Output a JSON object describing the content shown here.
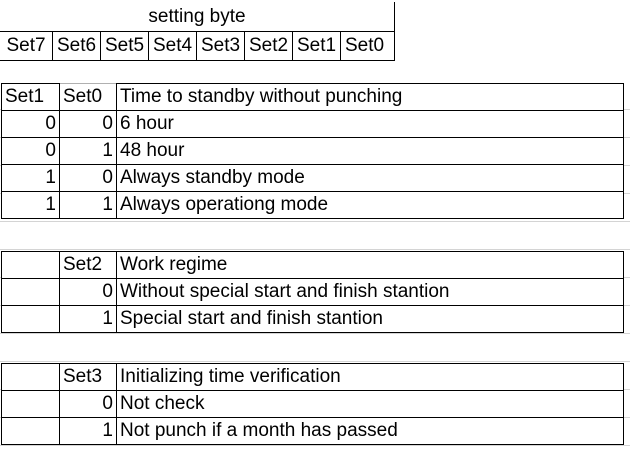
{
  "byte_table": {
    "title": "setting byte",
    "bits": [
      "Set7",
      "Set6",
      "Set5",
      "Set4",
      "Set3",
      "Set2",
      "Set1",
      "Set0"
    ]
  },
  "blocks": [
    {
      "header": [
        "Set1",
        "Set0",
        "Time to standby without punching"
      ],
      "rows": [
        [
          "0",
          "0",
          "6 hour"
        ],
        [
          "0",
          "1",
          "48 hour"
        ],
        [
          "1",
          "0",
          "Always standby mode"
        ],
        [
          "1",
          "1",
          "Always operationg mode"
        ]
      ]
    },
    {
      "header": [
        "",
        "Set2",
        "Work regime"
      ],
      "rows": [
        [
          "",
          "0",
          "Without special start and finish stantion"
        ],
        [
          "",
          "1",
          "Special start and finish stantion"
        ]
      ]
    },
    {
      "header": [
        "",
        "Set3",
        "Initializing time verification"
      ],
      "rows": [
        [
          "",
          "0",
          "Not check"
        ],
        [
          "",
          "1",
          "Not punch if a month has passed"
        ]
      ]
    }
  ]
}
